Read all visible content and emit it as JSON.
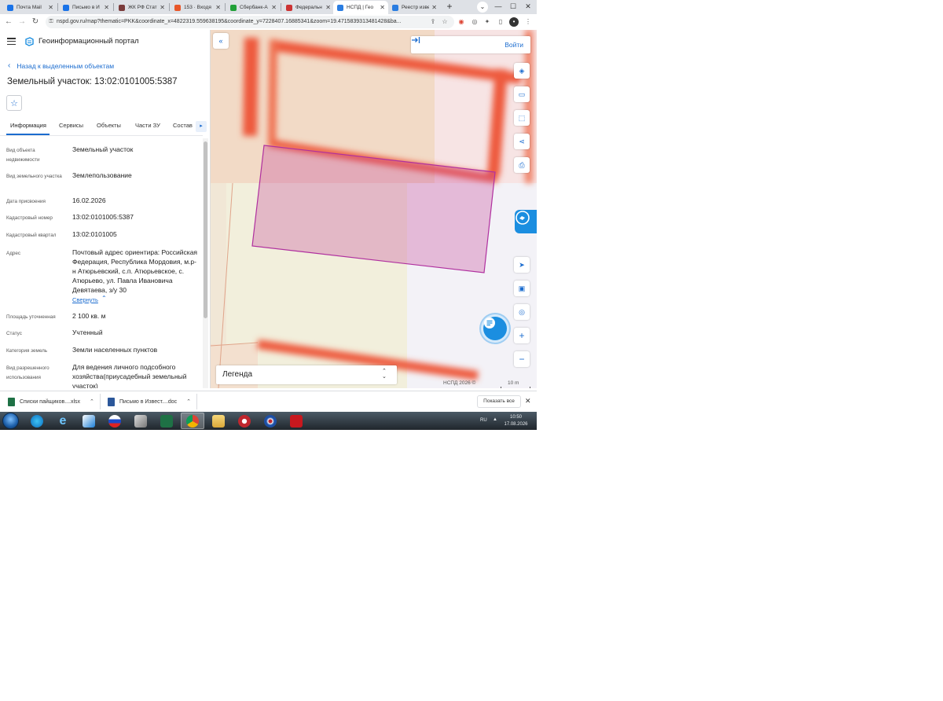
{
  "browser": {
    "tabs": [
      {
        "title": "Почта Mail",
        "color": "#1a73e8"
      },
      {
        "title": "Письмо в И",
        "color": "#1a73e8"
      },
      {
        "title": "ЖК РФ Стат",
        "color": "#7a3b3b"
      },
      {
        "title": "153 · Входя",
        "color": "#e8572a"
      },
      {
        "title": "Сбербанк-А",
        "color": "#21a038"
      },
      {
        "title": "Федеральн",
        "color": "#c33"
      },
      {
        "title": "НСПД | Гео",
        "color": "#2a7de1",
        "active": true
      },
      {
        "title": "Реестр изве",
        "color": "#2a7de1"
      }
    ],
    "url": "nspd.gov.ru/map?thematic=PKK&coordinate_x=4822319.559638195&coordinate_y=7228407.16885341&zoom=19.4715839313481428&ba..."
  },
  "app": {
    "title": "Геоинформационный портал"
  },
  "panel": {
    "back_link": "Назад к выделенным объектам",
    "title": "Земельный участок: 13:02:0101005:5387",
    "tabs": [
      "Информация",
      "Сервисы",
      "Объекты",
      "Части ЗУ",
      "Состав"
    ],
    "rows": [
      {
        "label": "Вид объекта недвижимости",
        "value": "Земельный участок"
      },
      {
        "label": "Вид земельного участка",
        "value": "Землепользование"
      },
      {
        "label": "Дата присвоения",
        "value": "16.02.2026"
      },
      {
        "label": "Кадастровый номер",
        "value": "13:02:0101005:5387"
      },
      {
        "label": "Кадастровый квартал",
        "value": "13:02:0101005"
      },
      {
        "label": "Адрес",
        "value": "Почтовый адрес ориентира: Российская Федерация, Республика Мордовия, м.р-н Атюрьевский, с.п. Атюрьевское, с. Атюрьево, ул. Павла Ивановича Девятаева, з/у 30"
      },
      {
        "label": "Площадь уточненная",
        "value": "2 100 кв. м"
      },
      {
        "label": "Статус",
        "value": "Учтенный"
      },
      {
        "label": "Категория земель",
        "value": "Земли населенных пунктов"
      },
      {
        "label": "Вид разрешенного использования",
        "value": "Для ведения личного подсобного хозяйства(приусадебный земельный участок)"
      }
    ],
    "collapse_link": "Свернуть"
  },
  "map": {
    "login": "Войти",
    "legend": "Легенда",
    "attribution": "НСПД 2026 ©",
    "scale": "10 m",
    "parcel_color": "#b0309f"
  },
  "downloads": {
    "items": [
      {
        "name": "Списки пайщиков....xlsx",
        "color": "#1e7145"
      },
      {
        "name": "Письмо в Извест....doc",
        "color": "#2b579a"
      }
    ],
    "show_all": "Показать все"
  },
  "taskbar": {
    "lang": "RU",
    "time": "10:50",
    "date": "17.08.2026"
  }
}
